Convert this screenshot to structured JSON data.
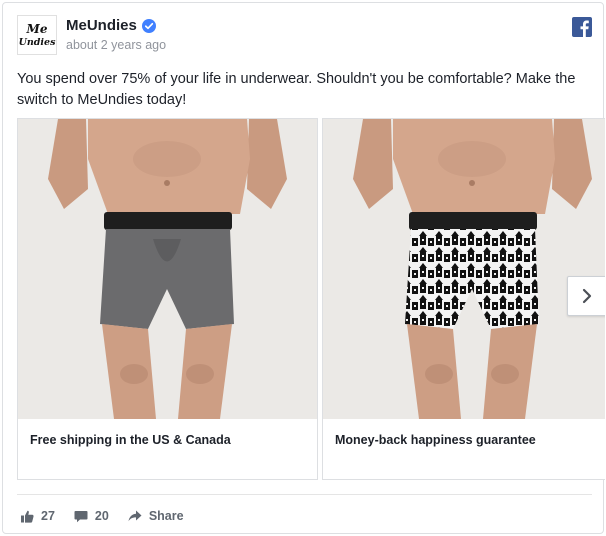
{
  "post": {
    "page_name": "MeUndies",
    "avatar_text_top": "Me",
    "avatar_text_bottom": "Undies",
    "timestamp": "about 2 years ago",
    "text": "You spend over 75% of your life in underwear. Shouldn't you be comfortable? Make the switch to MeUndies today!"
  },
  "carousel": {
    "slides": [
      {
        "caption": "Free shipping in the US & Canada",
        "image": "man-wearing-grey-boxer-briefs"
      },
      {
        "caption": "Money-back happiness guarantee",
        "image": "man-wearing-patterned-boxer-briefs"
      }
    ]
  },
  "actions": {
    "likes": "27",
    "comments": "20",
    "share_label": "Share"
  },
  "colors": {
    "facebook_blue": "#3b5998",
    "verified_blue": "#4080ff",
    "muted_text": "#90949c"
  }
}
